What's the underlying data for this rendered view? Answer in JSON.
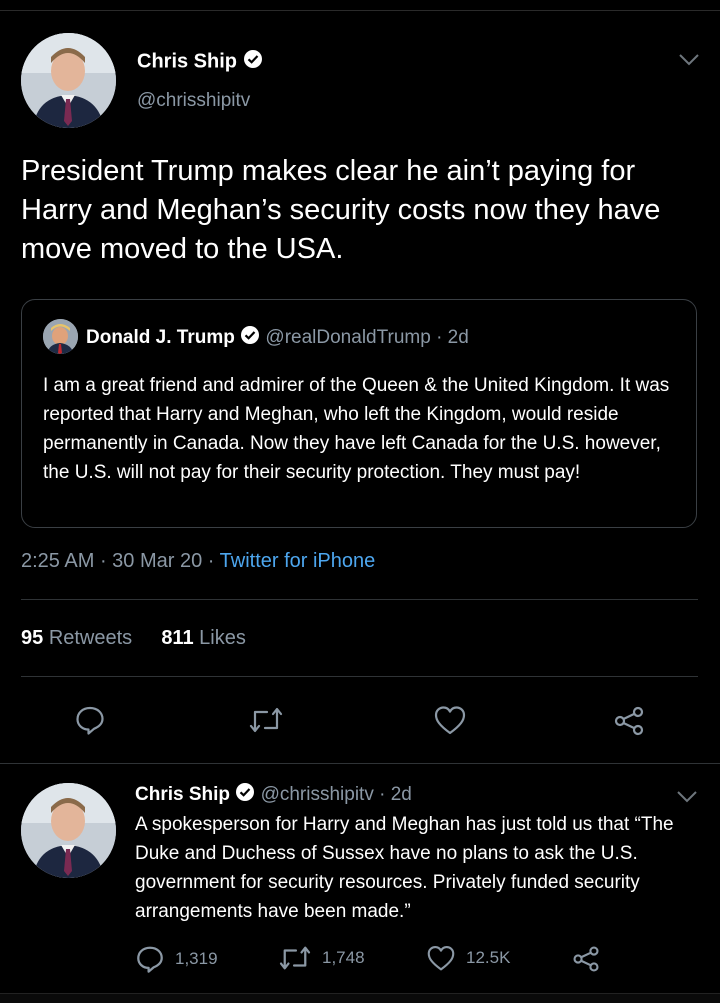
{
  "tweet": {
    "author_name": "Chris Ship",
    "author_handle": "@chrisshipitv",
    "text": "President Trump makes clear he ain’t paying for Harry and Meghan’s security costs now they have move moved to the USA.",
    "quote": {
      "author_name": "Donald J. Trump",
      "author_handle": "@realDonaldTrump",
      "age": "· 2d",
      "text": "I am a great friend and admirer of the Queen & the United Kingdom. It was reported that Harry and Meghan, who left the Kingdom, would reside permanently in Canada. Now they have left Canada for the U.S. however, the U.S. will not pay for their security protection. They must pay!"
    },
    "time": "2:25 AM",
    "date": "· 30 Mar 20 ·",
    "source": "Twitter for iPhone",
    "retweets_count": "95",
    "retweets_label": "Retweets",
    "likes_count": "811",
    "likes_label": "Likes"
  },
  "reply": {
    "author_name": "Chris Ship",
    "author_handle": "@chrisshipitv",
    "age": "· 2d",
    "text": "A spokesperson for Harry and Meghan has just told us that “The Duke and Duchess of Sussex have no plans to ask the U.S. government for security resources. Privately funded security arrangements have been made.”",
    "replies": "1,319",
    "retweets": "1,748",
    "likes": "12.5K"
  },
  "icons": {
    "verified": "verified-badge-icon",
    "chevron": "chevron-down-icon",
    "reply": "reply-icon",
    "retweet": "retweet-icon",
    "like": "heart-icon",
    "share": "share-icon"
  },
  "colors": {
    "background": "#000000",
    "link": "#4da6ee",
    "muted": "#8b98a5"
  }
}
